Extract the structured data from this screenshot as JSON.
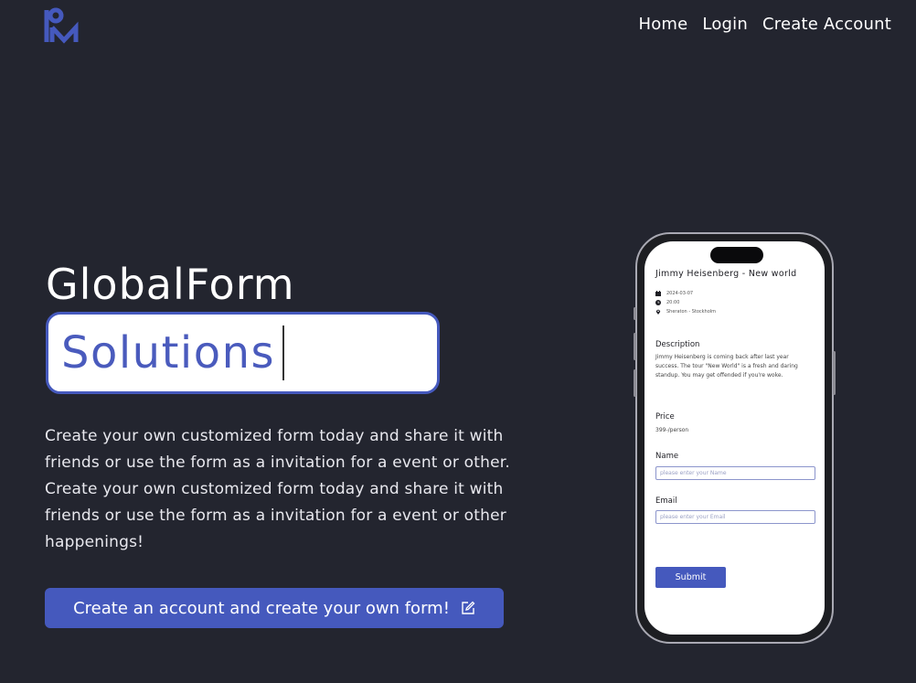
{
  "header": {
    "logo_text": "RM",
    "nav": [
      {
        "label": "Home"
      },
      {
        "label": "Login"
      },
      {
        "label": "Create Account"
      }
    ]
  },
  "hero": {
    "title": "GlobalForm",
    "typed_word": "Solutions",
    "description": "Create your own customized form today and share it with friends or use the form as a invitation for a event or other. Create your own customized form today and share it with friends or use the form as a invitation for a event or other happenings!",
    "cta_label": "Create an account and create your own form!"
  },
  "phone": {
    "event_title": "Jimmy Heisenberg - New world",
    "date": "2024-03-07",
    "time": "20:00",
    "location": "Sheraton - Stockholm",
    "description_heading": "Description",
    "description_text": "Jimmy Heisenberg is coming back after last year success. The tour \"New World\" is a fresh and daring standup. You may get offended if you're woke.",
    "price_heading": "Price",
    "price_text": "399-/person",
    "name_label": "Name",
    "name_placeholder": "please enter your Name",
    "email_label": "Email",
    "email_placeholder": "please enter your Email",
    "submit_label": "Submit"
  },
  "colors": {
    "background": "#23252f",
    "accent": "#4559bd",
    "text": "#ffffff"
  }
}
